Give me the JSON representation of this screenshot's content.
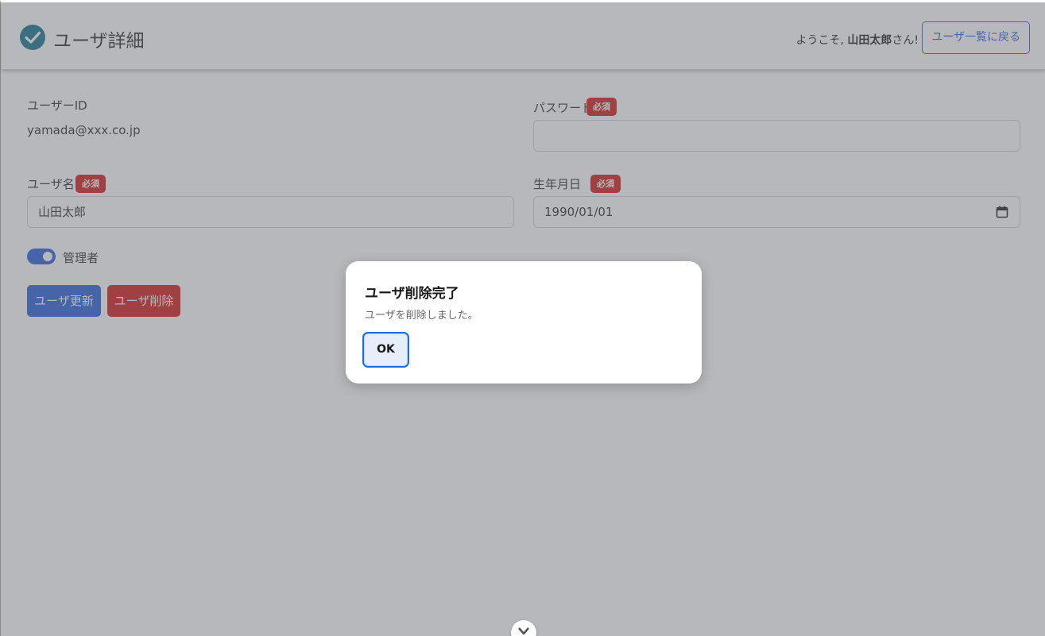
{
  "header": {
    "title": "ユーザ詳細",
    "welcome_prefix": "ようこそ,",
    "user_name": "山田太郎",
    "welcome_suffix": "さん!",
    "back_button": "ユーザ一覧に戻る"
  },
  "form": {
    "user_id_label": "ユーザーID",
    "user_id_value": "yamada@xxx.co.jp",
    "password_label": "パスワード",
    "password_value": "",
    "required_badge": "必須",
    "username_label": "ユーザ名",
    "username_value": "山田太郎",
    "birthday_label": "生年月日",
    "birthday_value": "1990/01/01",
    "admin_label": "管理者",
    "admin_enabled": true,
    "update_button": "ユーザ更新",
    "delete_button": "ユーザ削除"
  },
  "dialog": {
    "title": "ユーザ削除完了",
    "message": "ユーザを削除しました。",
    "ok_button": "OK"
  },
  "colors": {
    "primary": "#1e56d8",
    "danger": "#d20f0f",
    "logo": "#0a6a8a"
  },
  "icons": [
    "check-circle-icon",
    "calendar-icon",
    "chevron-down-icon"
  ]
}
